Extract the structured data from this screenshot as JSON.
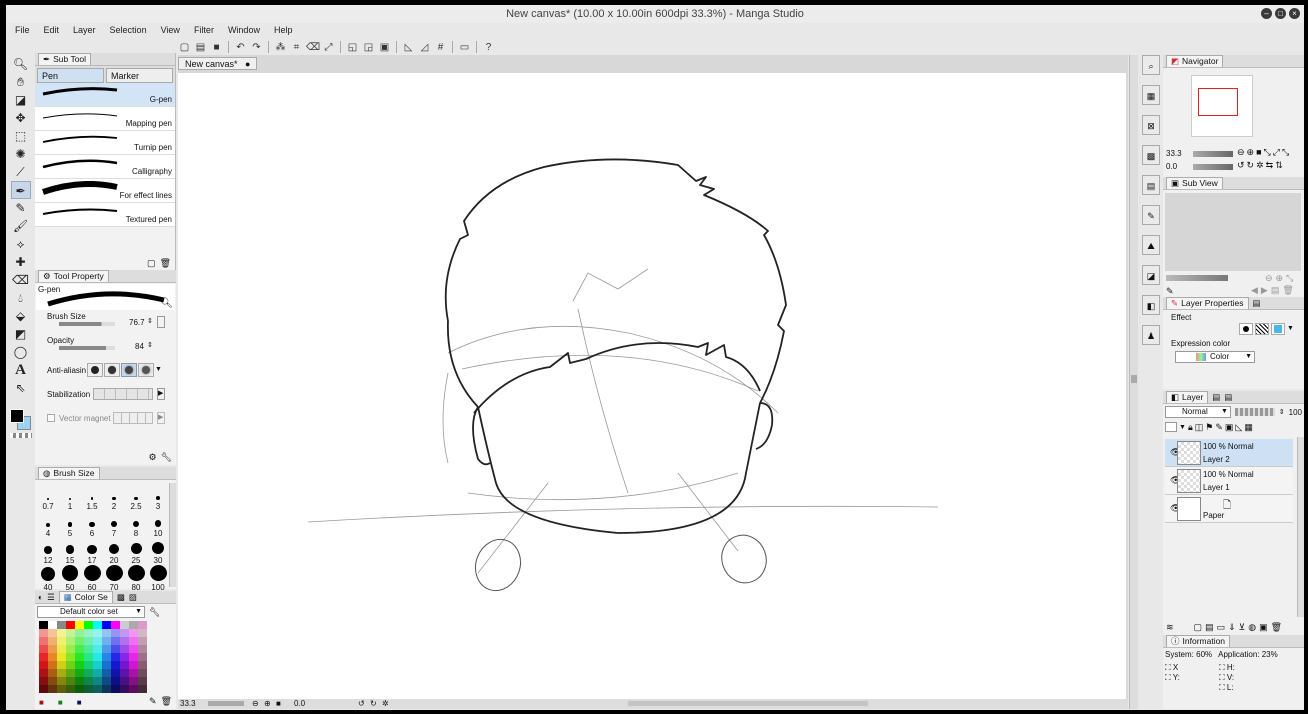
{
  "window": {
    "title": "New canvas* (10.00 x 10.00in 600dpi 33.3%)  - Manga Studio"
  },
  "menu": [
    "File",
    "Edit",
    "Layer",
    "Selection",
    "View",
    "Filter",
    "Window",
    "Help"
  ],
  "subtool": {
    "title": "Sub Tool",
    "tabs": [
      "Pen",
      "Marker"
    ],
    "brushes": [
      "G-pen",
      "Mapping pen",
      "Turnip pen",
      "Calligraphy",
      "For effect lines",
      "Textured pen"
    ]
  },
  "toolprop": {
    "title": "Tool Property",
    "preset": "G-pen",
    "brush_size_label": "Brush Size",
    "brush_size": "76.7",
    "opacity_label": "Opacity",
    "opacity": "84",
    "antialias_label": "Anti-aliasin",
    "stabilization_label": "Stabilization",
    "vector_magnet_label": "Vector magnet"
  },
  "brushsize": {
    "title": "Brush Size",
    "sizes": [
      "0.7",
      "1",
      "1.5",
      "2",
      "2.5",
      "3",
      "4",
      "5",
      "6",
      "7",
      "8",
      "10",
      "12",
      "15",
      "17",
      "20",
      "25",
      "30",
      "40",
      "50",
      "60",
      "70",
      "80",
      "100"
    ]
  },
  "colorset": {
    "title": "Color Se",
    "selected": "Default color set"
  },
  "canvas": {
    "tab": "New canvas*",
    "zoom": "33.3",
    "angle": "0.0"
  },
  "navigator": {
    "title": "Navigator",
    "zoom": "33.3",
    "angle": "0.0"
  },
  "subview": {
    "title": "Sub View"
  },
  "layerprop": {
    "title": "Layer Properties",
    "effect_label": "Effect",
    "expression_label": "Expression color",
    "expression_value": "Color"
  },
  "layers": {
    "title": "Layer",
    "blend": "Normal",
    "opacity": "100",
    "items": [
      {
        "pct": "100 %  Normal",
        "name": "Layer 2"
      },
      {
        "pct": "100 %  Normal",
        "name": "Layer 1"
      },
      {
        "pct": "",
        "name": "Paper"
      }
    ]
  },
  "info": {
    "title": "Information",
    "system": "System: 60%",
    "application": "Application: 23%",
    "x": "X",
    "y": "Y:",
    "h": "H:",
    "v": "V:",
    "l": "L:"
  }
}
